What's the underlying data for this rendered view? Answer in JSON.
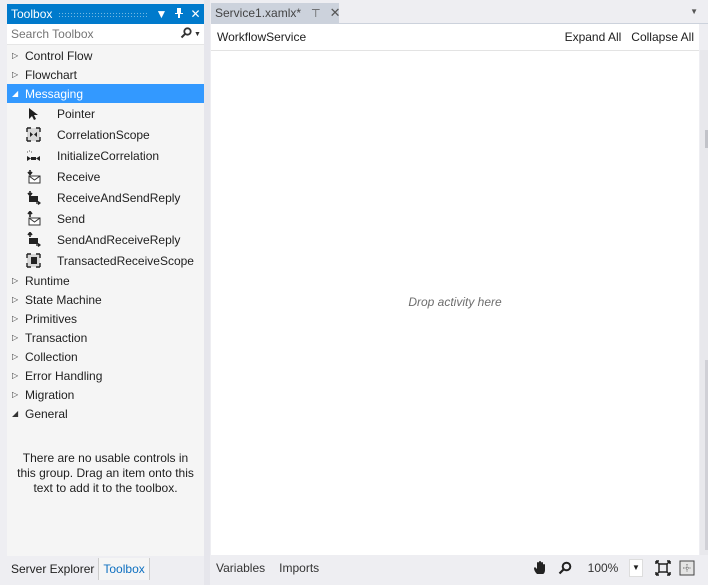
{
  "toolbox": {
    "title": "Toolbox",
    "search_placeholder": "Search Toolbox",
    "groups_before": [
      {
        "label": "Control Flow",
        "expanded": false
      },
      {
        "label": "Flowchart",
        "expanded": false
      }
    ],
    "selected_group": {
      "label": "Messaging",
      "expanded": true
    },
    "items": [
      {
        "label": "Pointer",
        "icon": "pointer-icon"
      },
      {
        "label": "CorrelationScope",
        "icon": "correlation-scope-icon"
      },
      {
        "label": "InitializeCorrelation",
        "icon": "initialize-correlation-icon"
      },
      {
        "label": "Receive",
        "icon": "receive-icon"
      },
      {
        "label": "ReceiveAndSendReply",
        "icon": "receive-and-send-reply-icon"
      },
      {
        "label": "Send",
        "icon": "send-icon"
      },
      {
        "label": "SendAndReceiveReply",
        "icon": "send-and-receive-reply-icon"
      },
      {
        "label": "TransactedReceiveScope",
        "icon": "transacted-receive-scope-icon"
      }
    ],
    "groups_after": [
      {
        "label": "Runtime",
        "expanded": false
      },
      {
        "label": "State Machine",
        "expanded": false
      },
      {
        "label": "Primitives",
        "expanded": false
      },
      {
        "label": "Transaction",
        "expanded": false
      },
      {
        "label": "Collection",
        "expanded": false
      },
      {
        "label": "Error Handling",
        "expanded": false
      },
      {
        "label": "Migration",
        "expanded": false
      },
      {
        "label": "General",
        "expanded": true
      }
    ],
    "empty_message": "There are no usable controls in this group. Drag an item onto this text to add it to the toolbox."
  },
  "bottom_tabs": {
    "server_explorer": "Server Explorer",
    "toolbox": "Toolbox",
    "active": "Toolbox"
  },
  "document": {
    "tab_label": "Service1.xamlx*",
    "breadcrumb": "WorkflowService",
    "expand_all": "Expand All",
    "collapse_all": "Collapse All",
    "drop_hint": "Drop activity here"
  },
  "statusbar": {
    "variables": "Variables",
    "imports": "Imports",
    "zoom": "100%"
  },
  "colors": {
    "accent": "#007acc",
    "selection": "#3399ff",
    "active_tab_text": "#0e70c0"
  }
}
